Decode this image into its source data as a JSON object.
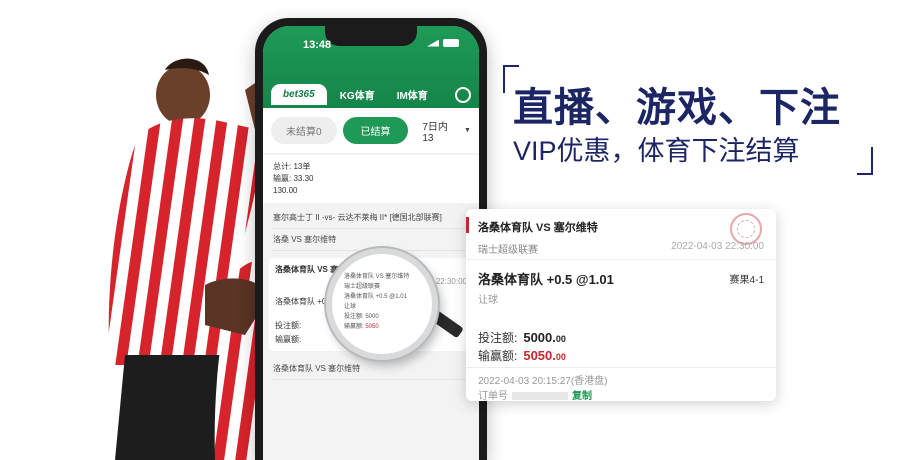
{
  "slogan": {
    "headline": "直播、游戏、下注",
    "subline": "VIP优惠，体育下注结算"
  },
  "phone": {
    "status_time": "13:48",
    "nav_tabs": [
      {
        "label": "bet365"
      },
      {
        "label": "KG体育"
      },
      {
        "label": "IM体育"
      }
    ],
    "filter": {
      "unsettled": "未结算0",
      "settled": "已结算",
      "range": "7日内13"
    },
    "summary": {
      "total": "总计: 13单",
      "win": "输赢: 33.30",
      "amount": "130.00"
    },
    "list": [
      {
        "text": "塞尔高士丁 II -vs- 云达不莱梅 II* [德国北部联赛]"
      },
      {
        "text": "洛桑 VS 塞尔维特"
      }
    ],
    "card": {
      "match": "洛桑体育队 VS 塞尔维特",
      "date": "2022-04-03 22:30:00",
      "pick": "洛桑体育队 +0.5 @1.01",
      "stake_label": "投注额:",
      "win_label": "输赢额:"
    },
    "list2": [
      {
        "text": "洛桑体育队 VS 塞尔维特"
      }
    ]
  },
  "magnifier": {
    "lines": [
      "洛桑体育队 VS 塞尔维特",
      "瑞士超级联赛",
      "洛桑体育队 +0.5 @1.01",
      "让球",
      "投注额:",
      "5000",
      "输赢额:",
      "5050"
    ]
  },
  "receipt": {
    "match": "洛桑体育队 VS 塞尔维特",
    "league": "瑞士超级联赛",
    "match_date": "2022-04-03 22:30:00",
    "pick": "洛桑体育队 +0.5 @1.01",
    "result": "赛果4-1",
    "bet_type": "让球",
    "stake_label": "投注额:",
    "stake_int": "5000.",
    "stake_dec": "00",
    "win_label": "输赢额:",
    "win_int": "5050.",
    "win_dec": "00",
    "placed_time": "2022-04-03 20:15:27(香港盘)",
    "order_label": "订单号",
    "copy_label": "复制"
  },
  "colors": {
    "brand_green": "#1f9a56",
    "navy": "#1c2664",
    "red": "#c8262c"
  }
}
